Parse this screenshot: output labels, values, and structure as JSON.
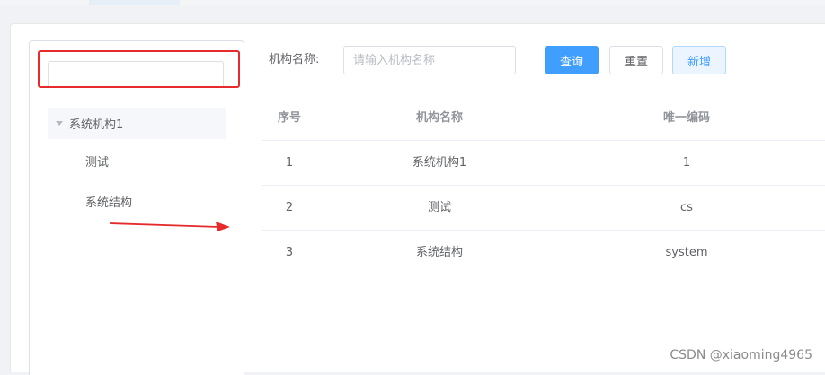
{
  "tree": {
    "search_value": "",
    "root_label": "系统机构1",
    "children": [
      {
        "label": "测试"
      },
      {
        "label": "系统结构"
      }
    ]
  },
  "filter": {
    "label": "机构名称:",
    "placeholder": "请输入机构名称",
    "query_label": "查询",
    "reset_label": "重置",
    "add_label": "新增"
  },
  "table": {
    "columns": [
      "序号",
      "机构名称",
      "唯一编码"
    ],
    "rows": [
      {
        "index": "1",
        "name": "系统机构1",
        "code": "1"
      },
      {
        "index": "2",
        "name": "测试",
        "code": "cs"
      },
      {
        "index": "3",
        "name": "系统结构",
        "code": "system"
      }
    ]
  },
  "annotations": {
    "highlight_color": "#e52b2b",
    "arrow_color": "#e52b2b"
  },
  "watermark": "CSDN @xiaoming4965",
  "colors": {
    "primary": "#409eff",
    "plain_bg": "#ecf5ff"
  }
}
